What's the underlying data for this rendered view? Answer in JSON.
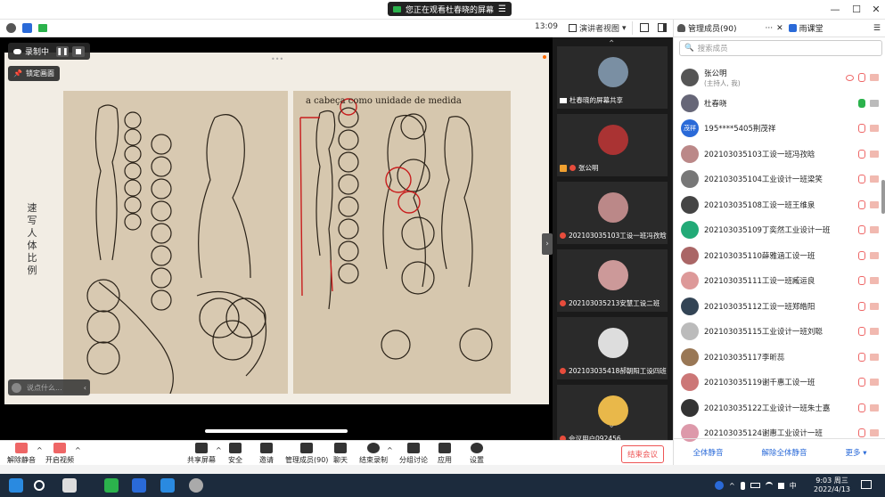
{
  "banner": {
    "text": "您正在观看杜春晓的屏幕",
    "menu_icon": "menu-icon"
  },
  "window": {
    "min": "—",
    "max": "☐",
    "close": "✕"
  },
  "topbar": {
    "time": "13:09",
    "view_mode": "演讲者视图",
    "view_caret": "▾"
  },
  "recording": {
    "label": "录制中"
  },
  "lock_screen": {
    "label": "锁定画面"
  },
  "chat": {
    "placeholder": "说点什么..."
  },
  "document": {
    "vertical_title": "速写人体比例",
    "right_heading": "a cabeça como unidade de medida"
  },
  "gallery": {
    "tiles": [
      {
        "label": "杜春晓的屏幕共享",
        "color": "#7a8fa3"
      },
      {
        "label": "张公明",
        "color": "#a33"
      },
      {
        "label": "202103035103工设一班冯孜晗",
        "color": "#b88"
      },
      {
        "label": "202103035213安慧工设二班",
        "color": "#c99"
      },
      {
        "label": "202103035418郝朝阳工设四班",
        "color": "#ddd"
      },
      {
        "label": "会议用户092456",
        "color": "#e9b84a"
      }
    ]
  },
  "panel": {
    "tab_members": "管理成员(90)",
    "tab_more": "···",
    "tab_close": "✕",
    "tab_class": "雨课堂",
    "search_placeholder": "搜索成员",
    "members": [
      {
        "name": "张公明",
        "sub": "(主持人, 我)",
        "color": "#555"
      },
      {
        "name": "杜春晓",
        "sub": "",
        "color": "#667"
      },
      {
        "name": "195****5405荆茂祥",
        "sub": "",
        "color": "#2a6ad8",
        "abbr": "茂祥"
      },
      {
        "name": "202103035103工设一班冯孜晗",
        "sub": "",
        "color": "#b88"
      },
      {
        "name": "202103035104工业设计一班梁笑",
        "sub": "",
        "color": "#777"
      },
      {
        "name": "202103035108工设一班王维泉",
        "sub": "",
        "color": "#444"
      },
      {
        "name": "202103035109丁奕然工业设计一班",
        "sub": "",
        "color": "#2a7"
      },
      {
        "name": "202103035110薛雅涵工设一班",
        "sub": "",
        "color": "#a66"
      },
      {
        "name": "202103035111工设一班臧运良",
        "sub": "",
        "color": "#d99"
      },
      {
        "name": "202103035112工设一班郑皓阳",
        "sub": "",
        "color": "#345"
      },
      {
        "name": "202103035115工业设计一班刘聪",
        "sub": "",
        "color": "#bbb"
      },
      {
        "name": "202103035117李昕蕊",
        "sub": "",
        "color": "#975"
      },
      {
        "name": "202103035119谢千惠工设一班",
        "sub": "",
        "color": "#c77"
      },
      {
        "name": "202103035122工业设计一班朱士嘉",
        "sub": "",
        "color": "#333"
      },
      {
        "name": "202103035124谢惠工业设计一班",
        "sub": "",
        "color": "#d9a"
      }
    ],
    "footer": {
      "mute_all": "全体静音",
      "unmute_all": "解除全体静音",
      "more": "更多 ▾"
    }
  },
  "toolbar": {
    "unmute": "解除静音",
    "video": "开启视频",
    "share": "共享屏幕",
    "security": "安全",
    "invite": "邀请",
    "members": "管理成员(90)",
    "chat": "聊天",
    "end_record": "结束录制",
    "breakout": "分组讨论",
    "apps": "应用",
    "settings": "设置",
    "end_meeting": "结束会议"
  },
  "taskbar": {
    "ime": "中",
    "time": "9:03 周三",
    "date": "2022/4/13"
  }
}
